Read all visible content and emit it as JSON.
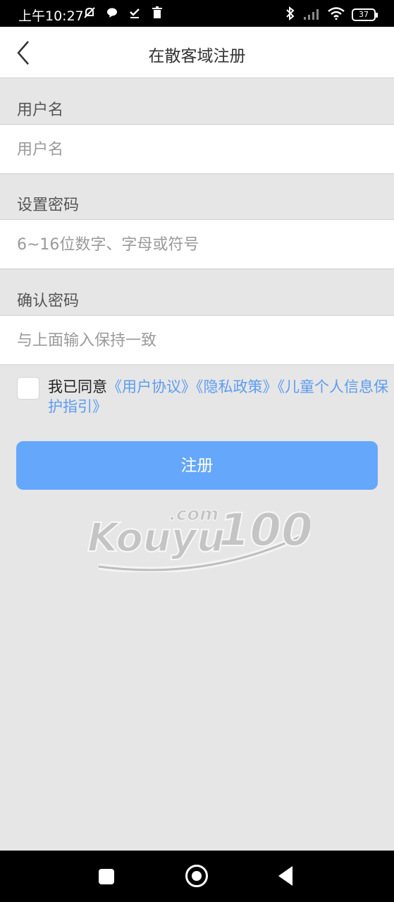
{
  "status_bar": {
    "time": "上午10:27",
    "battery": "37"
  },
  "header": {
    "title": "在散客域注册"
  },
  "form": {
    "username_label": "用户名",
    "username_placeholder": "用户名",
    "password_label": "设置密码",
    "password_placeholder": "6~16位数字、字母或符号",
    "confirm_label": "确认密码",
    "confirm_placeholder": "与上面输入保持一致"
  },
  "agreement": {
    "prefix": "我已同意",
    "user_agreement": "《用户协议》",
    "privacy_policy": "《隐私政策》",
    "child_policy": "《儿童个人信息保护指引》"
  },
  "register_button": "注册",
  "logo": {
    "text": "Kouyu",
    "number": "100",
    "suffix": ".com"
  }
}
